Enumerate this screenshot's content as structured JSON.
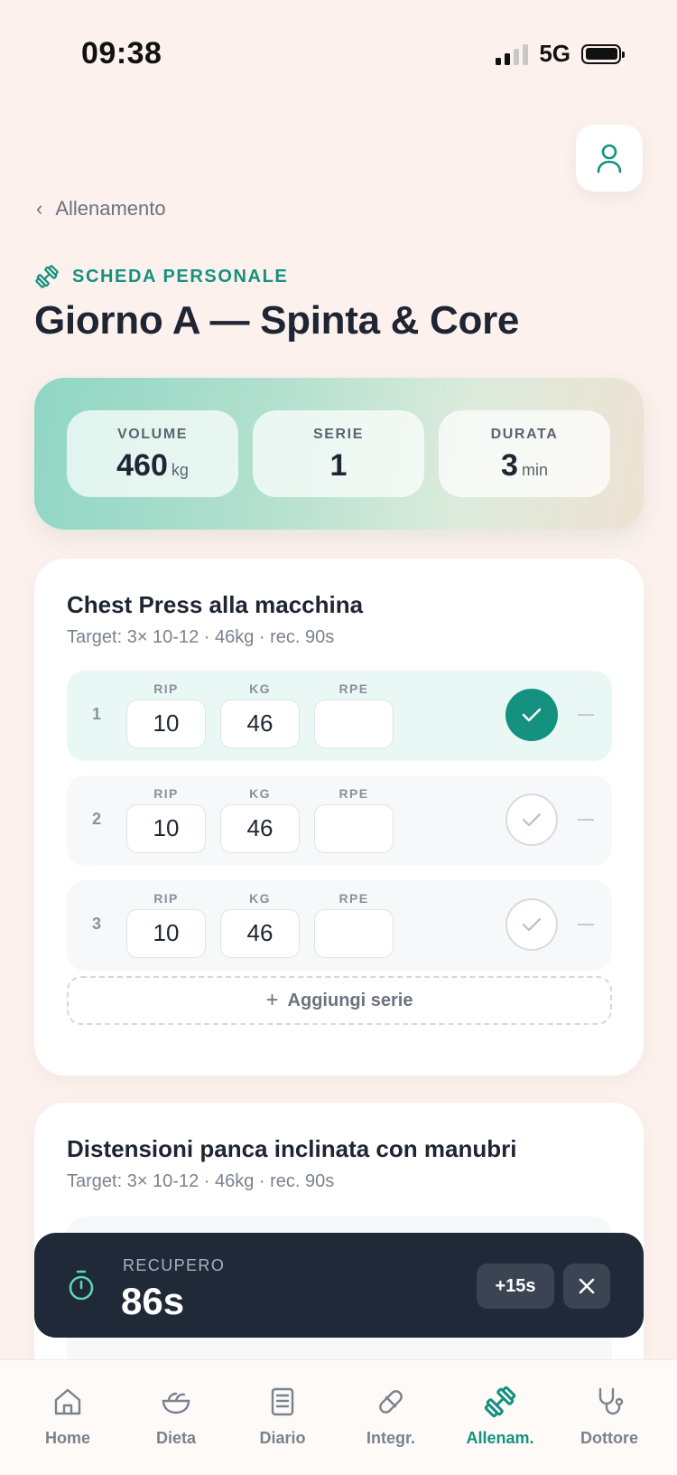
{
  "status_bar": {
    "time": "09:38",
    "network": "5G"
  },
  "header": {
    "back_label": "Allenamento",
    "kicker": "SCHEDA PERSONALE",
    "title": "Giorno A — Spinta & Core"
  },
  "summary": [
    {
      "label": "VOLUME",
      "value": "460",
      "unit": "kg"
    },
    {
      "label": "SERIE",
      "value": "1",
      "unit": ""
    },
    {
      "label": "DURATA",
      "value": "3",
      "unit": "min"
    }
  ],
  "colors": {
    "accent": "#14917f",
    "background": "#fcf1ec",
    "timer_bg": "#1f2937"
  },
  "exercises": [
    {
      "name": "Chest Press alla macchina",
      "target": "Target: 3× 10-12 · 46kg · rec. 90s",
      "field_labels": {
        "reps": "RIP",
        "kg": "KG",
        "rpe": "RPE"
      },
      "sets": [
        {
          "num": "1",
          "reps": "10",
          "kg": "46",
          "rpe": "",
          "done": true
        },
        {
          "num": "2",
          "reps": "10",
          "kg": "46",
          "rpe": "",
          "done": false
        },
        {
          "num": "3",
          "reps": "10",
          "kg": "46",
          "rpe": "",
          "done": false
        }
      ],
      "add_label": "Aggiungi serie"
    },
    {
      "name": "Distensioni panca inclinata con manubri",
      "target": "Target: 3× 10-12 · 46kg · rec. 90s"
    }
  ],
  "rest_timer": {
    "label": "RECUPERO",
    "value": "86s",
    "plus_label": "+15s"
  },
  "nav": [
    {
      "label": "Home",
      "icon": "home-icon"
    },
    {
      "label": "Dieta",
      "icon": "salad-bowl-icon"
    },
    {
      "label": "Diario",
      "icon": "notebook-icon"
    },
    {
      "label": "Integr.",
      "icon": "pill-icon"
    },
    {
      "label": "Allenam.",
      "icon": "dumbbell-icon",
      "active": true
    },
    {
      "label": "Dottore",
      "icon": "stethoscope-icon"
    }
  ]
}
